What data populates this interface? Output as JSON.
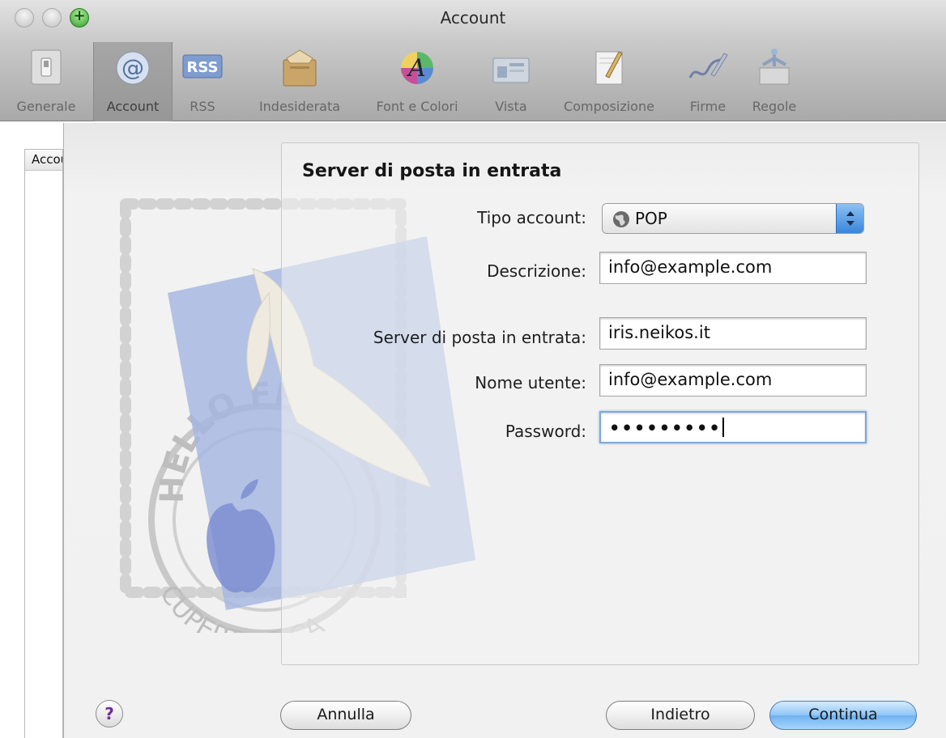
{
  "window": {
    "title": "Account"
  },
  "toolbar": {
    "items": [
      {
        "label": "Generale",
        "icon": "general-switch-icon",
        "selected": false
      },
      {
        "label": "Account",
        "icon": "at-sign-icon",
        "selected": true
      },
      {
        "label": "RSS",
        "icon": "rss-icon",
        "selected": false
      },
      {
        "label": "Indesiderata",
        "icon": "junk-mail-icon",
        "selected": false
      },
      {
        "label": "Font e Colori",
        "icon": "fonts-colors-icon",
        "selected": false
      },
      {
        "label": "Vista",
        "icon": "viewing-icon",
        "selected": false
      },
      {
        "label": "Composizione",
        "icon": "composing-icon",
        "selected": false
      },
      {
        "label": "Firme",
        "icon": "signature-icon",
        "selected": false
      },
      {
        "label": "Regole",
        "icon": "rules-icon",
        "selected": false
      }
    ]
  },
  "sidebar": {
    "header": "Account"
  },
  "stamp": {
    "text_top": "HELLO FR",
    "text_bottom": "CUPERTINO CA"
  },
  "form": {
    "heading": "Server di posta in entrata",
    "account_type": {
      "label": "Tipo account:",
      "value": "POP"
    },
    "description": {
      "label": "Descrizione:",
      "value": "info@example.com"
    },
    "incoming_server": {
      "label": "Server di posta in entrata:",
      "value": "iris.neikos.it"
    },
    "username": {
      "label": "Nome utente:",
      "value": "info@example.com"
    },
    "password": {
      "label": "Password:",
      "masked": "•••••••••"
    }
  },
  "buttons": {
    "help": "?",
    "cancel": "Annulla",
    "back": "Indietro",
    "continue": "Continua"
  },
  "colors": {
    "accent": "#6eb2f1",
    "focus_ring": "#7fa9d8",
    "help_mark": "#6e2aa0"
  }
}
